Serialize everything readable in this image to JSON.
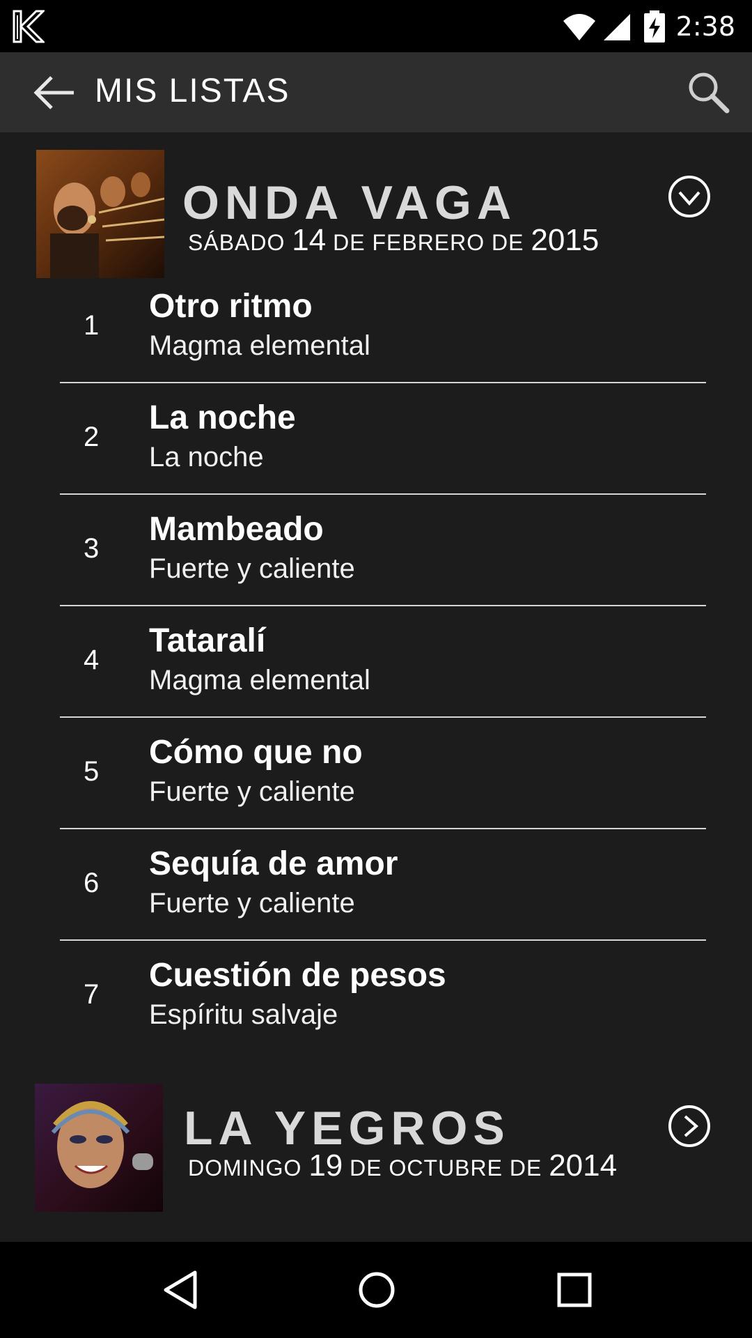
{
  "status_bar": {
    "time": "2:38",
    "icons": [
      "app-logo-icon",
      "wifi-icon",
      "signal-icon",
      "battery-charging-icon"
    ]
  },
  "app_bar": {
    "title": "MIS LISTAS",
    "back_icon": "arrow-left-icon",
    "search_icon": "search-icon"
  },
  "events": [
    {
      "name": "ONDA VAGA",
      "date": {
        "weekday": "SÁBADO",
        "day": "14",
        "mid": "DE FEBRERO DE",
        "year": "2015"
      },
      "toggle_icon": "chevron-down-circle-icon",
      "expanded": true,
      "tracks": [
        {
          "number": "1",
          "title": "Otro ritmo",
          "album": "Magma elemental"
        },
        {
          "number": "2",
          "title": "La noche",
          "album": "La noche"
        },
        {
          "number": "3",
          "title": "Mambeado",
          "album": "Fuerte y caliente"
        },
        {
          "number": "4",
          "title": "Tataralí",
          "album": "Magma elemental"
        },
        {
          "number": "5",
          "title": "Cómo que no",
          "album": "Fuerte y caliente"
        },
        {
          "number": "6",
          "title": "Sequía de amor",
          "album": "Fuerte y caliente"
        },
        {
          "number": "7",
          "title": "Cuestión de pesos",
          "album": "Espíritu salvaje"
        }
      ]
    },
    {
      "name": "LA YEGROS",
      "date": {
        "weekday": "DOMINGO",
        "day": "19",
        "mid": "DE OCTUBRE DE",
        "year": "2014"
      },
      "toggle_icon": "chevron-right-circle-icon",
      "expanded": false
    }
  ],
  "nav_bar": {
    "icons": [
      "back-triangle-icon",
      "home-circle-icon",
      "recents-square-icon"
    ]
  }
}
